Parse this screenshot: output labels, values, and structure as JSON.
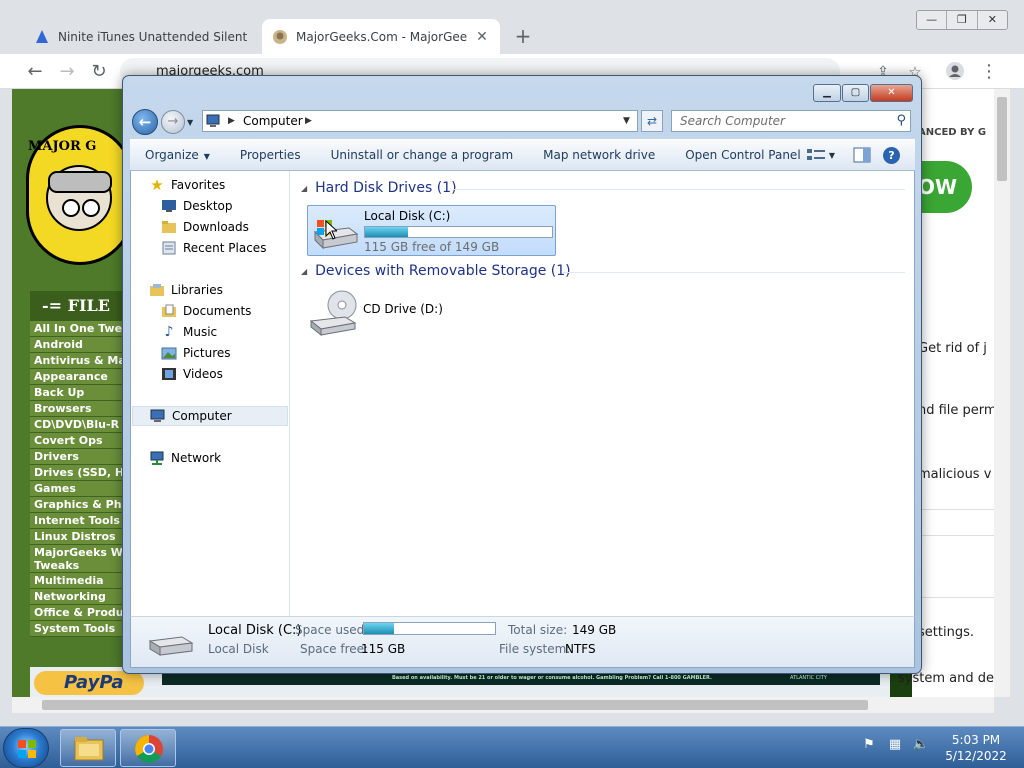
{
  "browser": {
    "tabs": [
      {
        "title": "Ninite iTunes Unattended Silent I",
        "active": false
      },
      {
        "title": "MajorGeeks.Com - MajorGeeks",
        "active": true
      }
    ],
    "new_tab": "+",
    "url": "majorgeeks.com",
    "window_controls": {
      "minimize": "—",
      "restore": "❐",
      "close": "✕"
    }
  },
  "site": {
    "logo_text": "MAJOR G",
    "categories_header": "-= FILE",
    "categories": [
      "All In One Twe",
      "Android",
      "Antivirus & Ma",
      "Appearance",
      "Back Up",
      "Browsers",
      "CD\\DVD\\Blu-R",
      "Covert Ops",
      "Drivers",
      "Drives (SSD, H",
      "Games",
      "Graphics & Pho",
      "Internet Tools",
      "Linux Distros",
      "MajorGeeks W Tweaks",
      "Multimedia",
      "Networking",
      "Office & Produ",
      "System Tools"
    ],
    "enhanced_by": "ANCED BY G",
    "download_button": "OW",
    "right_texts": [
      "Get rid of j",
      "nd file perm",
      "malicious v",
      "settings.",
      "system and decry"
    ],
    "paypal": "PayPa",
    "ad_text": "Based on availability. Must be 21 or older to wager or consume alcohol. Gambling Problem? Call 1-800 GAMBLER.",
    "ad_brand": "ATLANTIC CITY"
  },
  "explorer": {
    "caption_buttons": {
      "minimize": "▁",
      "maximize": "▢",
      "close": "✕"
    },
    "address": "Computer",
    "search_placeholder": "Search Computer",
    "commands": {
      "organize": "Organize",
      "properties": "Properties",
      "uninstall": "Uninstall or change a program",
      "map_drive": "Map network drive",
      "control_panel": "Open Control Panel"
    },
    "nav": {
      "favorites": "Favorites",
      "desktop": "Desktop",
      "downloads": "Downloads",
      "recent": "Recent Places",
      "libraries": "Libraries",
      "documents": "Documents",
      "music": "Music",
      "pictures": "Pictures",
      "videos": "Videos",
      "computer": "Computer",
      "network": "Network"
    },
    "groups": {
      "hdd": "Hard Disk Drives (1)",
      "removable": "Devices with Removable Storage (1)"
    },
    "drive_c": {
      "name": "Local Disk (C:)",
      "free_text": "115 GB free of 149 GB",
      "used_fraction": 0.228
    },
    "drive_d": {
      "name": "CD Drive (D:)"
    },
    "details": {
      "name": "Local Disk (C:)",
      "type": "Local Disk",
      "space_used_label": "Space used:",
      "space_free_label": "Space free:",
      "space_free": "115 GB",
      "total_size_label": "Total size:",
      "total_size": "149 GB",
      "file_system_label": "File system:",
      "file_system": "NTFS"
    }
  },
  "taskbar": {
    "time": "5:03 PM",
    "date": "5/12/2022"
  }
}
